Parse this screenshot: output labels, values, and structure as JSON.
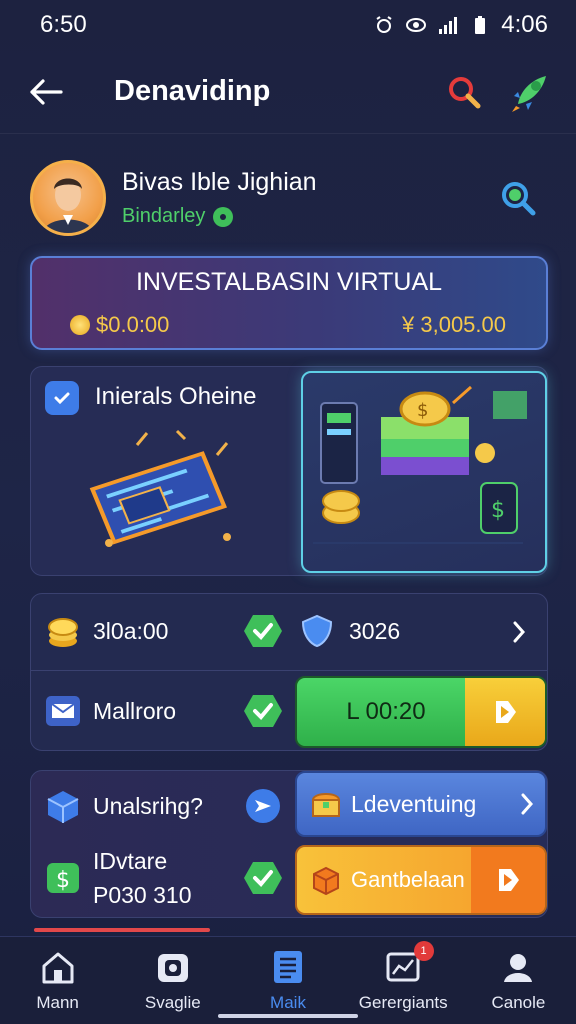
{
  "status": {
    "time_left": "6:50",
    "time_right": "4:06"
  },
  "header": {
    "title": "Denavidinp",
    "back_icon": "back-arrow-icon",
    "search_icon": "search-icon",
    "rocket_icon": "rocket-icon"
  },
  "profile": {
    "name": "Bivas Ible Jighian",
    "subtitle": "Bindarley"
  },
  "invest": {
    "title": "INVESTALBASIN VIRTUAL",
    "balance_left": "$0.0:00",
    "balance_right": "¥ 3,005.00"
  },
  "feature": {
    "title": "Inierals Oheine"
  },
  "panel1": {
    "row1": {
      "label": "3l0a:00",
      "right_value": "3026"
    },
    "row2": {
      "label": "Mallroro",
      "button": "L 00:20"
    }
  },
  "panel2": {
    "row1": {
      "label": "Unalsrihg?",
      "button": "Ldeventuing"
    },
    "row2": {
      "label_line1": "IDvtare",
      "label_line2": "P030 310",
      "button": "Gantbelaan"
    }
  },
  "nav": [
    {
      "label": "Mann",
      "icon": "home-icon"
    },
    {
      "label": "Svaglie",
      "icon": "wallet-icon"
    },
    {
      "label": "Maik",
      "icon": "document-icon"
    },
    {
      "label": "Gerergiants",
      "icon": "chart-icon",
      "badge": "1"
    },
    {
      "label": "Canole",
      "icon": "profile-icon"
    }
  ],
  "colors": {
    "accent": "#4a8cf0",
    "green": "#3fbf5a",
    "gold": "#f5c94a",
    "background": "#1e2547"
  }
}
